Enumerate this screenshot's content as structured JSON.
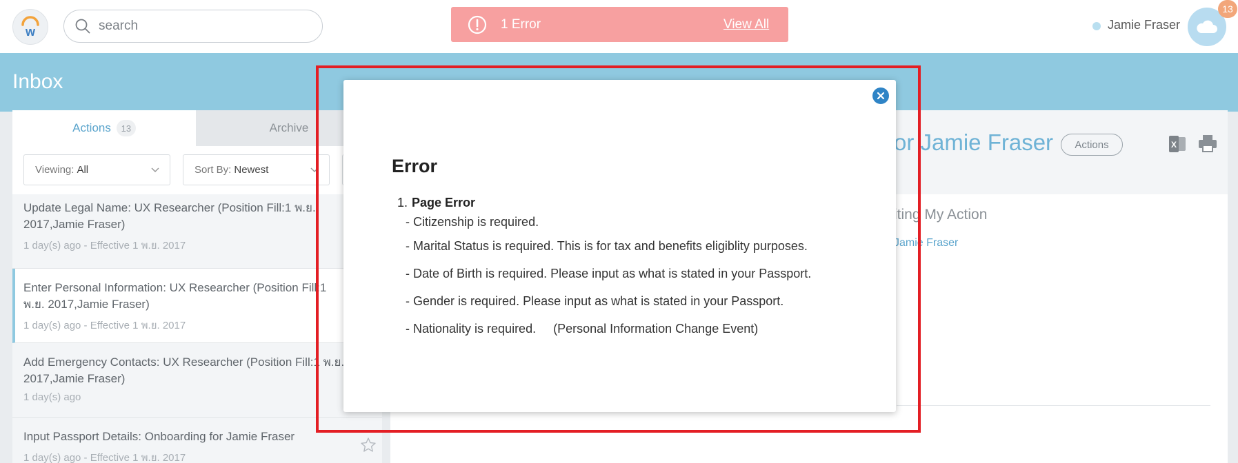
{
  "topbar": {
    "search_placeholder": "search",
    "error_banner": {
      "count_text": "1 Error",
      "view_all": "View All"
    },
    "user_name": "Jamie Fraser",
    "notification_count": "13"
  },
  "inbox": {
    "title": "Inbox",
    "tabs": [
      {
        "label": "Actions",
        "count": "13"
      },
      {
        "label": "Archive"
      }
    ],
    "filters": {
      "viewing_label": "Viewing:",
      "viewing_value": "All",
      "sort_label": "Sort By:",
      "sort_value": "Newest"
    },
    "items": [
      {
        "title": "Update Legal Name: UX Researcher (Position Fill:1 พ.ย. 2017,Jamie Fraser)",
        "meta": "1 day(s) ago - Effective 1 พ.ย. 2017"
      },
      {
        "title": "Enter Personal Information: UX Researcher (Position Fill:1 พ.ย. 2017,Jamie Fraser)",
        "meta": "1 day(s) ago - Effective 1 พ.ย. 2017"
      },
      {
        "title": "Add Emergency Contacts: UX Researcher (Position Fill:1 พ.ย. 2017,Jamie Fraser)",
        "meta": "1 day(s) ago"
      },
      {
        "title": "Input Passport Details: Onboarding for Jamie Fraser",
        "meta": "1 day(s) ago - Effective 1 พ.ย. 2017"
      }
    ]
  },
  "detail": {
    "title": "or Jamie Fraser",
    "actions_label": "Actions",
    "sub_heading": "iting My Action",
    "assignee": "Jamie Fraser"
  },
  "modal": {
    "title": "Error",
    "heading_number": "1.",
    "heading_label": "Page Error",
    "lines": [
      "- Citizenship is required.",
      "- Marital Status is required. This is for tax and benefits eligiblity purposes.",
      "- Date of Birth is required. Please input as what is stated in your Passport.",
      "- Gender is required. Please input as what is stated in your Passport.",
      "- Nationality is required.     (Personal Information Change Event)"
    ]
  },
  "colors": {
    "accent_blue": "#8fc9e0",
    "link_blue": "#5aa4cc",
    "error_banner": "#f7a0a0",
    "highlight_red": "#e31e24",
    "close_button": "#2f84c6"
  },
  "icons": [
    "workday-logo-icon",
    "search-icon",
    "alert-icon",
    "cloud-icon",
    "chevron-down-icon",
    "star-icon",
    "excel-icon",
    "print-icon",
    "close-icon"
  ]
}
